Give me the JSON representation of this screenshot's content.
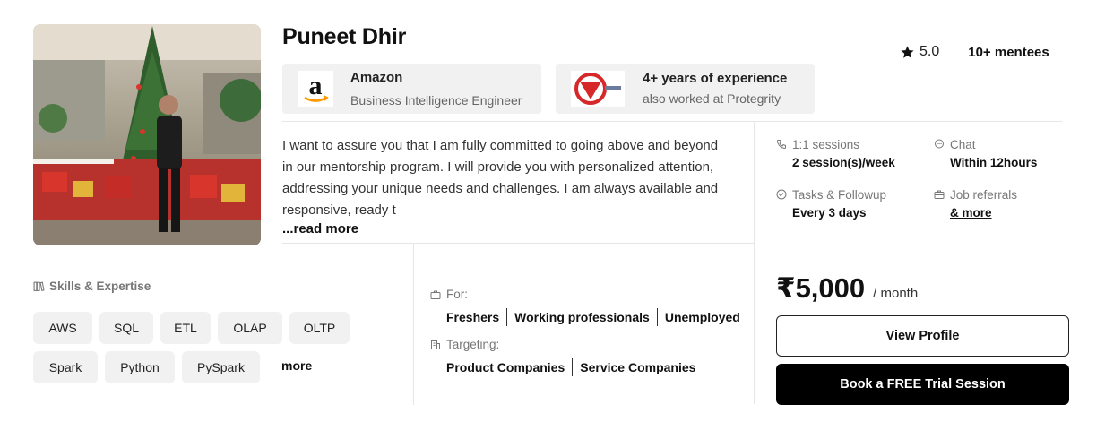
{
  "mentor": {
    "name": "Puneet Dhir",
    "rating": "5.0",
    "mentees": "10+ mentees"
  },
  "company": {
    "name": "Amazon",
    "role": "Business Intelligence Engineer"
  },
  "experience": {
    "title": "4+ years of experience",
    "also": "also worked at Protegrity"
  },
  "bio": {
    "text": "I want to assure you that I am fully committed to going above and beyond in our mentorship program. I will provide you with personalized attention, addressing your unique needs and challenges. I am always available and responsive, ready t",
    "read_more": "...read more"
  },
  "features": {
    "sessions_label": "1:1 sessions",
    "sessions_value": "2 session(s)/week",
    "chat_label": "Chat",
    "chat_value": "Within 12hours",
    "tasks_label": "Tasks & Followup",
    "tasks_value": "Every 3 days",
    "referrals_label": "Job referrals",
    "referrals_value": "& more"
  },
  "skills": {
    "heading": "Skills & Expertise",
    "items": [
      "AWS",
      "SQL",
      "ETL",
      "OLAP",
      "OLTP",
      "Spark",
      "Python",
      "PySpark"
    ],
    "more": "more"
  },
  "for": {
    "label": "For:",
    "items": [
      "Freshers",
      "Working professionals",
      "Unemployed"
    ]
  },
  "targeting": {
    "label": "Targeting:",
    "items": [
      "Product Companies",
      "Service Companies"
    ]
  },
  "pricing": {
    "amount": "₹5,000",
    "period": "/ month"
  },
  "actions": {
    "view_profile": "View Profile",
    "book_trial": "Book a FREE Trial Session"
  },
  "colors": {
    "amazon_orange": "#ff9900",
    "protegrity_red": "#d62828",
    "button_dark": "#000000",
    "card_bg": "#f1f1f1"
  }
}
